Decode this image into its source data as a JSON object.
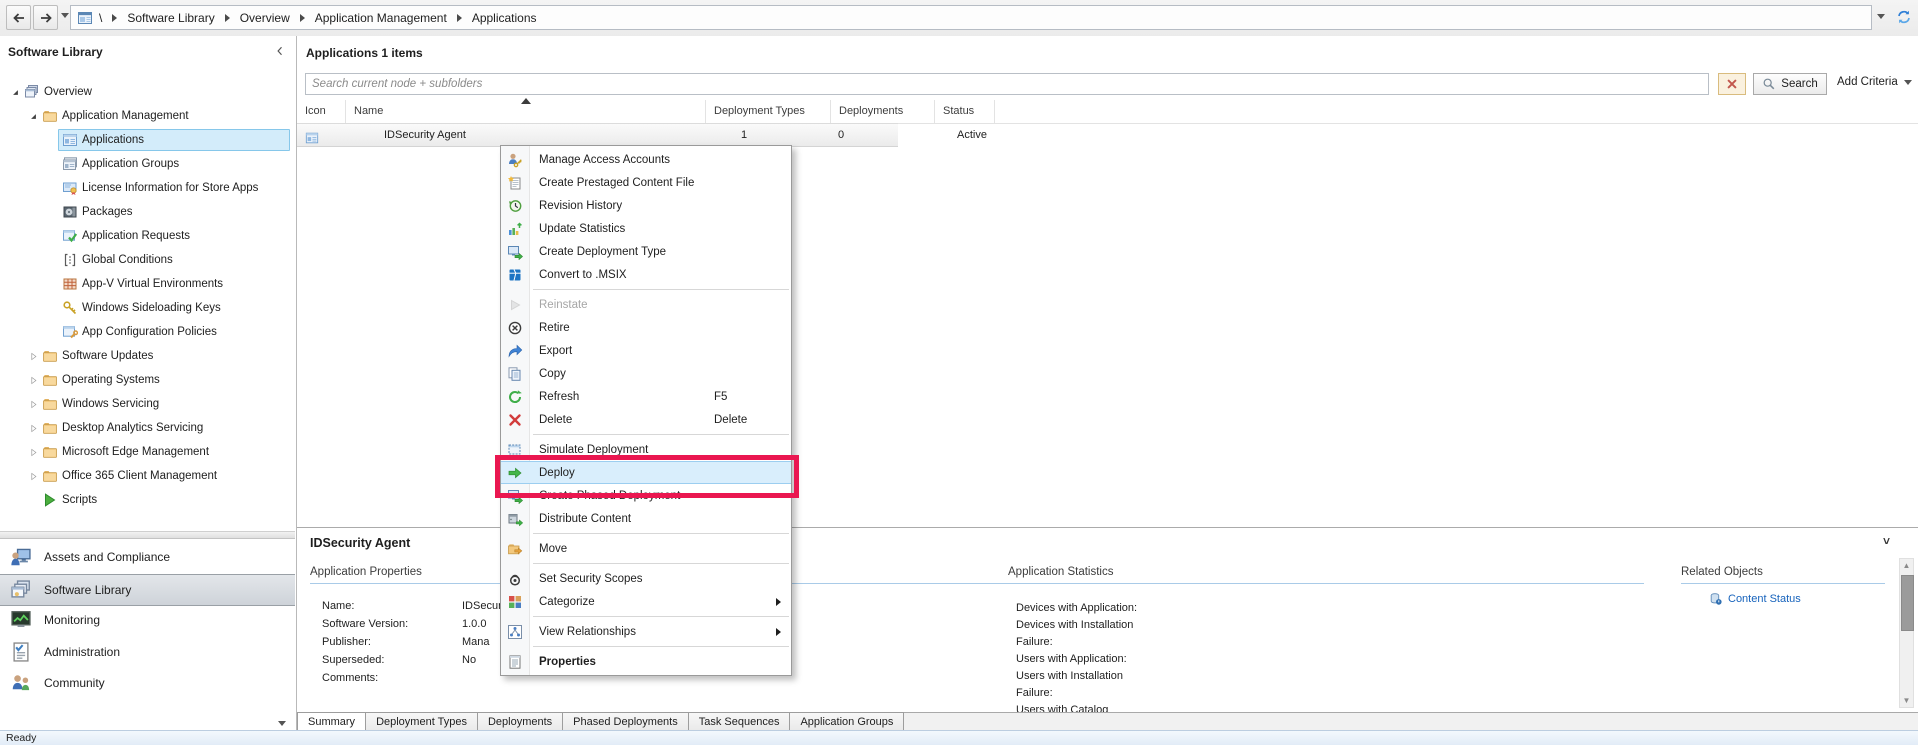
{
  "colors": {
    "annotation_red": "#ea1750",
    "selection_blue": "#d3ecfa",
    "link_blue": "#1763bc",
    "section_underline": "#a9cbe8"
  },
  "titlebar": {
    "back_icon": "back-arrow-icon",
    "forward_icon": "forward-arrow-icon",
    "refresh_icon": "refresh-icon",
    "breadcrumb_root": "\\",
    "breadcrumb": [
      "Software Library",
      "Overview",
      "Application Management",
      "Applications"
    ]
  },
  "sidebar": {
    "header": "Software Library",
    "tree": [
      {
        "label": "Overview",
        "level": 1,
        "icon": "overview-icon",
        "state": "expanded"
      },
      {
        "label": "Application Management",
        "level": 2,
        "icon": "folder-icon",
        "state": "expanded"
      },
      {
        "label": "Applications",
        "level": 3,
        "icon": "applications-icon",
        "selected": true
      },
      {
        "label": "Application Groups",
        "level": 3,
        "icon": "application-groups-icon"
      },
      {
        "label": "License Information for Store Apps",
        "level": 3,
        "icon": "license-icon"
      },
      {
        "label": "Packages",
        "level": 3,
        "icon": "packages-icon"
      },
      {
        "label": "Application Requests",
        "level": 3,
        "icon": "application-requests-icon"
      },
      {
        "label": "Global Conditions",
        "level": 3,
        "icon": "global-conditions-icon"
      },
      {
        "label": "App-V Virtual Environments",
        "level": 3,
        "icon": "appv-icon"
      },
      {
        "label": "Windows Sideloading Keys",
        "level": 3,
        "icon": "key-icon"
      },
      {
        "label": "App Configuration Policies",
        "level": 3,
        "icon": "app-config-icon"
      },
      {
        "label": "Software Updates",
        "level": 2,
        "icon": "folder-icon",
        "state": "collapsed"
      },
      {
        "label": "Operating Systems",
        "level": 2,
        "icon": "folder-icon",
        "state": "collapsed"
      },
      {
        "label": "Windows Servicing",
        "level": 2,
        "icon": "folder-icon",
        "state": "collapsed"
      },
      {
        "label": "Desktop Analytics Servicing",
        "level": 2,
        "icon": "folder-icon",
        "state": "collapsed"
      },
      {
        "label": "Microsoft Edge Management",
        "level": 2,
        "icon": "folder-icon",
        "state": "collapsed"
      },
      {
        "label": "Office 365 Client Management",
        "level": 2,
        "icon": "folder-icon",
        "state": "collapsed"
      },
      {
        "label": "Scripts",
        "level": 2,
        "icon": "scripts-icon"
      }
    ],
    "nav": [
      {
        "label": "Assets and Compliance",
        "icon": "assets-icon"
      },
      {
        "label": "Software Library",
        "icon": "software-library-icon",
        "selected": true
      },
      {
        "label": "Monitoring",
        "icon": "monitoring-icon"
      },
      {
        "label": "Administration",
        "icon": "administration-icon"
      },
      {
        "label": "Community",
        "icon": "community-icon"
      }
    ]
  },
  "main": {
    "title": "Applications 1 items",
    "search": {
      "placeholder": "Search current node + subfolders",
      "clear_icon": "clear-x-icon",
      "search_icon": "search-icon",
      "search_label": "Search",
      "add_criteria_label": "Add Criteria"
    },
    "table": {
      "columns": [
        "Icon",
        "Name",
        "Deployment Types",
        "Deployments",
        "Status"
      ],
      "sorted_column": "Name",
      "rows": [
        {
          "icon": "app-row-icon",
          "name": "IDSecurity Agent",
          "deployment_types": "1",
          "deployments": "0",
          "status": "Active"
        }
      ]
    }
  },
  "context_menu": {
    "items": [
      {
        "label": "Manage Access Accounts",
        "icon": "user-key-icon"
      },
      {
        "label": "Create Prestaged Content File",
        "icon": "prestaged-file-icon"
      },
      {
        "label": "Revision History",
        "icon": "revision-history-icon"
      },
      {
        "label": "Update Statistics",
        "icon": "update-statistics-icon"
      },
      {
        "label": "Create Deployment Type",
        "icon": "create-deployment-type-icon"
      },
      {
        "label": "Convert to .MSIX",
        "icon": "msix-icon",
        "separator_after": true
      },
      {
        "label": "Reinstate",
        "icon": "reinstate-icon",
        "disabled": true
      },
      {
        "label": "Retire",
        "icon": "retire-icon"
      },
      {
        "label": "Export",
        "icon": "export-icon"
      },
      {
        "label": "Copy",
        "icon": "copy-icon"
      },
      {
        "label": "Refresh",
        "icon": "refresh-green-icon",
        "shortcut": "F5"
      },
      {
        "label": "Delete",
        "icon": "delete-icon",
        "shortcut": "Delete",
        "separator_after": true
      },
      {
        "label": "Simulate Deployment",
        "icon": "simulate-deployment-icon"
      },
      {
        "label": "Deploy",
        "icon": "deploy-icon",
        "highlighted": true
      },
      {
        "label": "Create Phased Deployment",
        "icon": "phased-deployment-icon"
      },
      {
        "label": "Distribute Content",
        "icon": "distribute-content-icon",
        "separator_after": true
      },
      {
        "label": "Move",
        "icon": "move-icon",
        "separator_after": true
      },
      {
        "label": "Set Security Scopes",
        "icon": "security-scopes-icon"
      },
      {
        "label": "Categorize",
        "icon": "categorize-icon",
        "submenu": true,
        "separator_after": true
      },
      {
        "label": "View Relationships",
        "icon": "view-relationships-icon",
        "submenu": true,
        "separator_after": true
      },
      {
        "label": "Properties",
        "icon": "properties-icon",
        "bold": true
      }
    ]
  },
  "summary": {
    "title": "IDSecurity Agent",
    "properties": {
      "header": "Application Properties",
      "rows": [
        {
          "label": "Name:",
          "value": "IDSecurity Agent"
        },
        {
          "label": "Software Version:",
          "value": "1.0.0"
        },
        {
          "label": "Publisher:",
          "value": "Mana"
        },
        {
          "label": "Superseded:",
          "value": "No"
        },
        {
          "label": "Comments:",
          "value": ""
        }
      ]
    },
    "statistics": {
      "header": "Application Statistics",
      "lines": [
        "Devices with Application:",
        "Devices with Installation",
        "Failure:",
        "Users with Application:",
        "Users with Installation",
        "Failure:",
        "Users with Catalog"
      ]
    },
    "related": {
      "header": "Related Objects",
      "links": [
        {
          "label": "Content Status",
          "icon": "content-status-icon"
        }
      ]
    },
    "tabs": [
      {
        "label": "Summary",
        "active": true
      },
      {
        "label": "Deployment Types"
      },
      {
        "label": "Deployments"
      },
      {
        "label": "Phased Deployments"
      },
      {
        "label": "Task Sequences"
      },
      {
        "label": "Application Groups"
      }
    ]
  },
  "statusbar": {
    "text": "Ready"
  }
}
